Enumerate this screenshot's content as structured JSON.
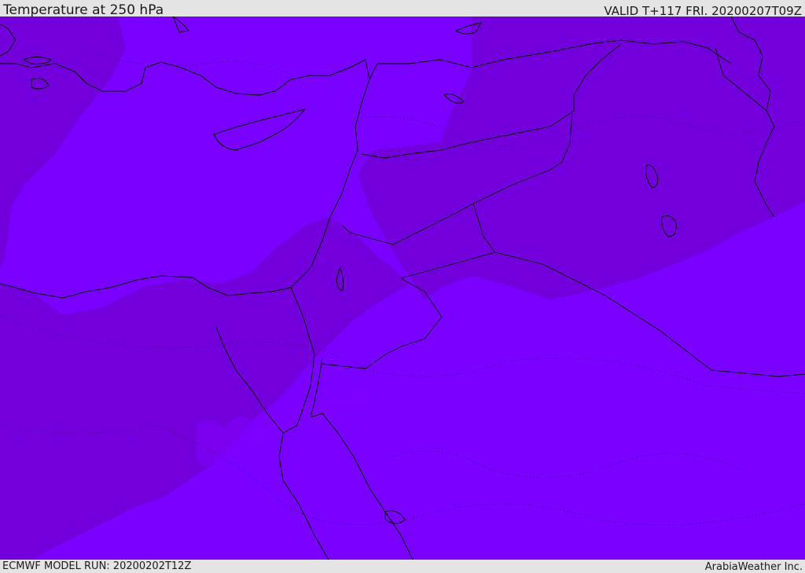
{
  "header": {
    "title": "Temperature at 250 hPa",
    "valid": "VALID T+117 FRI. 20200207T09Z"
  },
  "footer": {
    "model_run": "ECMWF MODEL RUN: 20200202T12Z",
    "credit": "ArabiaWeather Inc."
  },
  "map": {
    "colors": {
      "cold_band": "#7a00ff",
      "colder_band": "#7300dc",
      "coastline": "#000000",
      "contour": "#3a007a"
    }
  }
}
